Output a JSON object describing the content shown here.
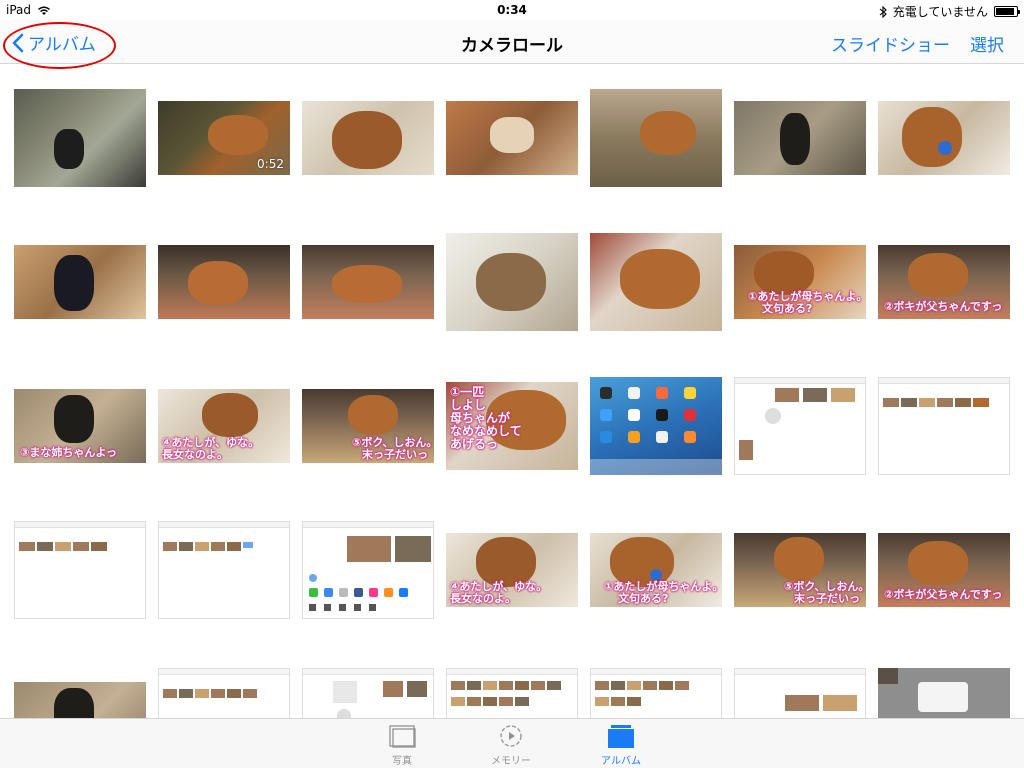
{
  "status": {
    "device": "iPad",
    "time": "0:34",
    "charging_text": "充電していません"
  },
  "nav": {
    "back_label": "アルバム",
    "title": "カメラロール",
    "slideshow_label": "スライドショー",
    "select_label": "選択"
  },
  "grid": {
    "video_duration": "0:52",
    "captions": {
      "c2_5": [
        "①あたしが母ちゃんよ。",
        "文句ある?"
      ],
      "c2_6": [
        "②ボキが父ちゃんですっ"
      ],
      "c3_0": [
        "③まな姉ちゃんよっ"
      ],
      "c3_1": [
        "④あたしが、ゆな。",
        "長女なのよ。"
      ],
      "c3_2": [
        "⑤ボク、しおん。",
        "末っ子だいっ"
      ],
      "c3_3": [
        "①一匹",
        "しよし",
        "母ちゃんが",
        "なめなめして",
        "あげるっ"
      ],
      "c4_3": [
        "④あたしが、ゆな。",
        "長女なのよ。"
      ],
      "c4_4": [
        "①あたしが母ちゃんよ。",
        "文句ある?"
      ],
      "c4_5": [
        "⑤ボク、しおん。",
        "末っ子だいっ"
      ],
      "c4_6": [
        "②ボキが父ちゃんですっ"
      ]
    }
  },
  "tabs": [
    {
      "label": "写真",
      "icon": "photos-icon",
      "active": false
    },
    {
      "label": "メモリー",
      "icon": "memories-icon",
      "active": false
    },
    {
      "label": "アルバム",
      "icon": "albums-icon",
      "active": true
    }
  ],
  "colors": {
    "accent": "#1a7cf5",
    "highlight": "#e00000",
    "caption_stroke": "#d02080"
  }
}
